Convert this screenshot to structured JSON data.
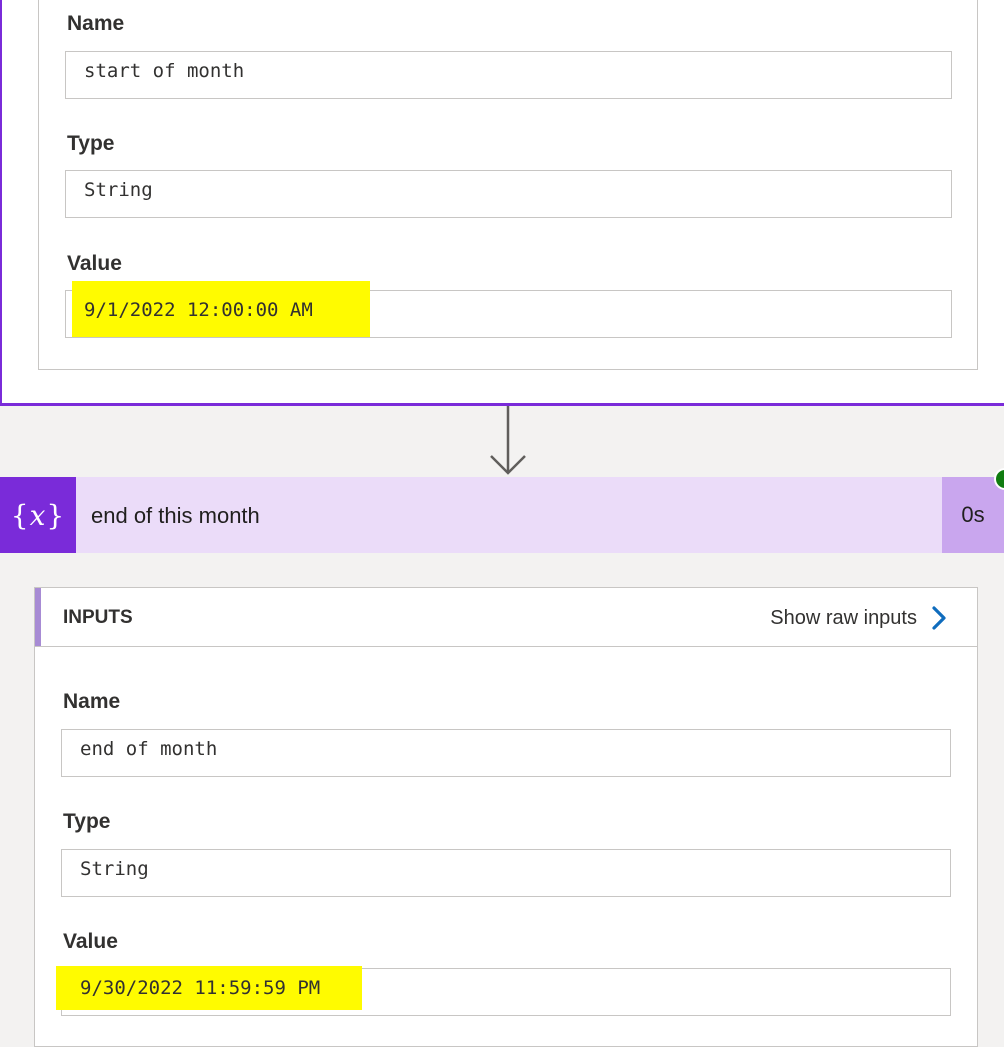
{
  "previous_step": {
    "fields": {
      "name": {
        "label": "Name",
        "value": "start of month"
      },
      "type": {
        "label": "Type",
        "value": "String"
      },
      "value": {
        "label": "Value",
        "value": "9/1/2022 12:00:00 AM"
      }
    }
  },
  "action": {
    "icon": "variable-icon",
    "icon_text": "{𝑥}",
    "title": "end of this month",
    "duration": "0s",
    "status_color": "#107c10",
    "accent_color": "#7a2bd9"
  },
  "inputs": {
    "header": "INPUTS",
    "show_raw_label": "Show raw inputs",
    "fields": {
      "name": {
        "label": "Name",
        "value": "end of month"
      },
      "type": {
        "label": "Type",
        "value": "String"
      },
      "value": {
        "label": "Value",
        "value": "9/30/2022 11:59:59 PM"
      }
    }
  },
  "highlight_color": "#fffb00"
}
